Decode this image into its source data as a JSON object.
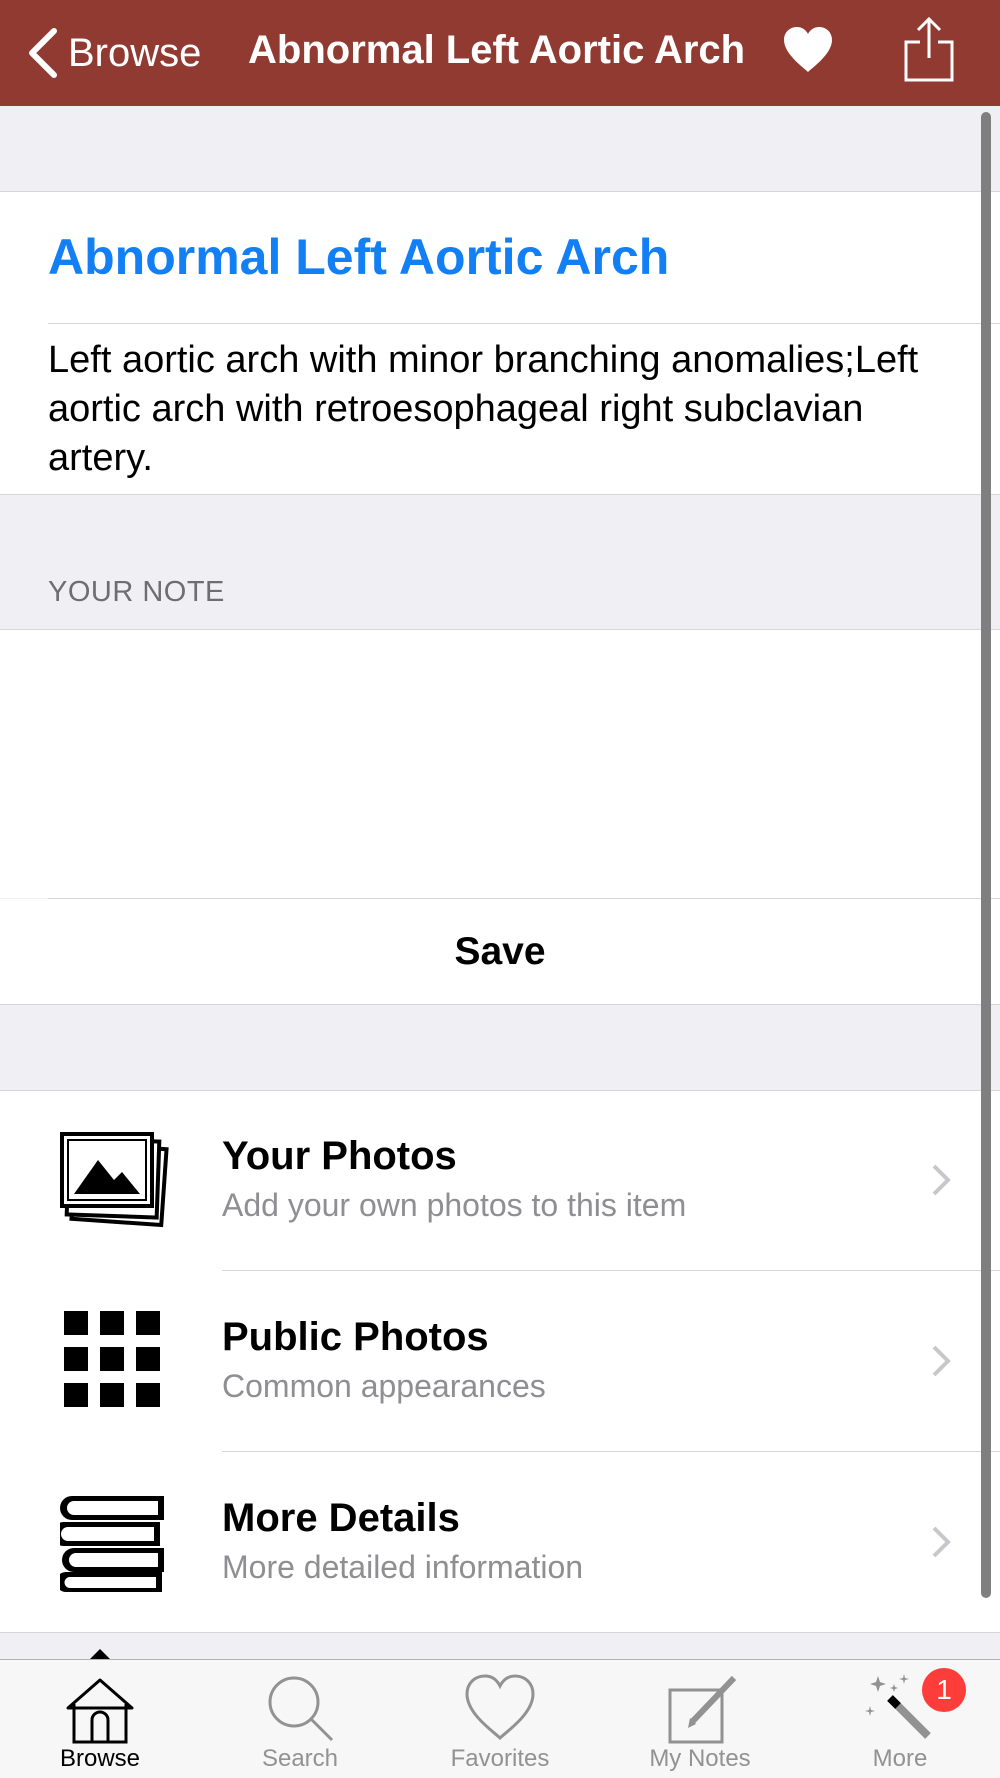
{
  "navbar": {
    "back_label": "Browse",
    "title": "Abnormal Left Aortic Arch",
    "favorite_icon": "heart-icon",
    "share_icon": "share-icon",
    "background": "#913a32"
  },
  "item": {
    "title": "Abnormal Left Aortic Arch",
    "description": "Left aortic arch with minor branching anomalies;Left aortic arch with retroesophageal right subclavian artery.",
    "title_color": "#127ff5"
  },
  "note": {
    "section_header": "YOUR NOTE",
    "value": "",
    "save_label": "Save"
  },
  "rows": [
    {
      "title": "Your Photos",
      "subtitle": "Add your own photos to this item",
      "icon": "photo-stack-icon"
    },
    {
      "title": "Public Photos",
      "subtitle": "Common appearances",
      "icon": "grid-icon"
    },
    {
      "title": "More Details",
      "subtitle": "More detailed information",
      "icon": "books-icon"
    }
  ],
  "tabbar": {
    "tabs": [
      {
        "label": "Browse",
        "icon": "home-icon",
        "active": true
      },
      {
        "label": "Search",
        "icon": "search-icon",
        "active": false
      },
      {
        "label": "Favorites",
        "icon": "heart-outline-icon",
        "active": false
      },
      {
        "label": "My Notes",
        "icon": "note-edit-icon",
        "active": false
      },
      {
        "label": "More",
        "icon": "magic-wand-icon",
        "active": false,
        "badge": "1"
      }
    ]
  }
}
